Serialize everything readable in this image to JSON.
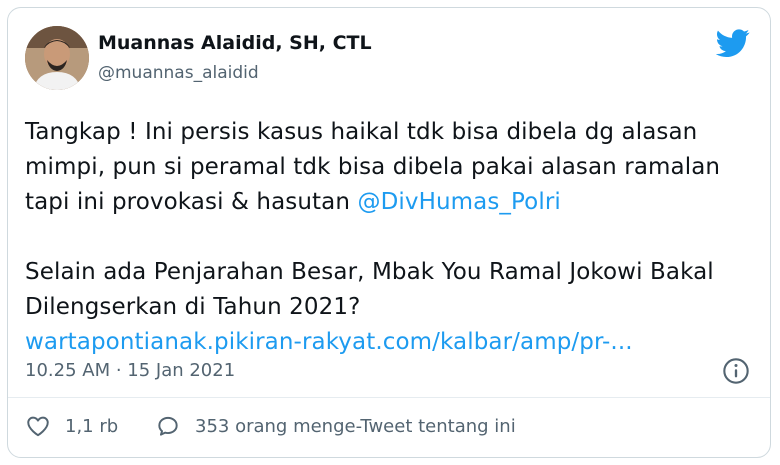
{
  "tweet": {
    "author_name": "Muannas Alaidid, SH, CTL",
    "author_handle": "@muannas_alaidid",
    "line1": "Tangkap ! Ini persis kasus haikal tdk bisa dibela dg alasan",
    "line2": "mimpi, pun si peramal tdk bisa dibela pakai alasan ramalan",
    "line3_prefix": "tapi ini provokasi & hasutan ",
    "mention": "@DivHumas_Polri",
    "line4": "Selain ada Penjarahan Besar, Mbak You Ramal Jokowi Bakal",
    "line5": "Dilengserkan di Tahun 2021?",
    "url": "wartapontianak.pikiran-rakyat.com/kalbar/amp/pr-...",
    "timestamp": "10.25 AM · 15 Jan 2021",
    "likes": "1,1 rb",
    "retweet_text": "353 orang menge-Tweet tentang ini"
  },
  "icons": {
    "brand": "twitter-bird-icon",
    "info": "info-icon",
    "like": "heart-icon",
    "reply_tweet": "speech-bubble-icon"
  },
  "colors": {
    "link": "#1d9bf0",
    "secondary_text": "#536471",
    "border": "#cfd9de"
  }
}
